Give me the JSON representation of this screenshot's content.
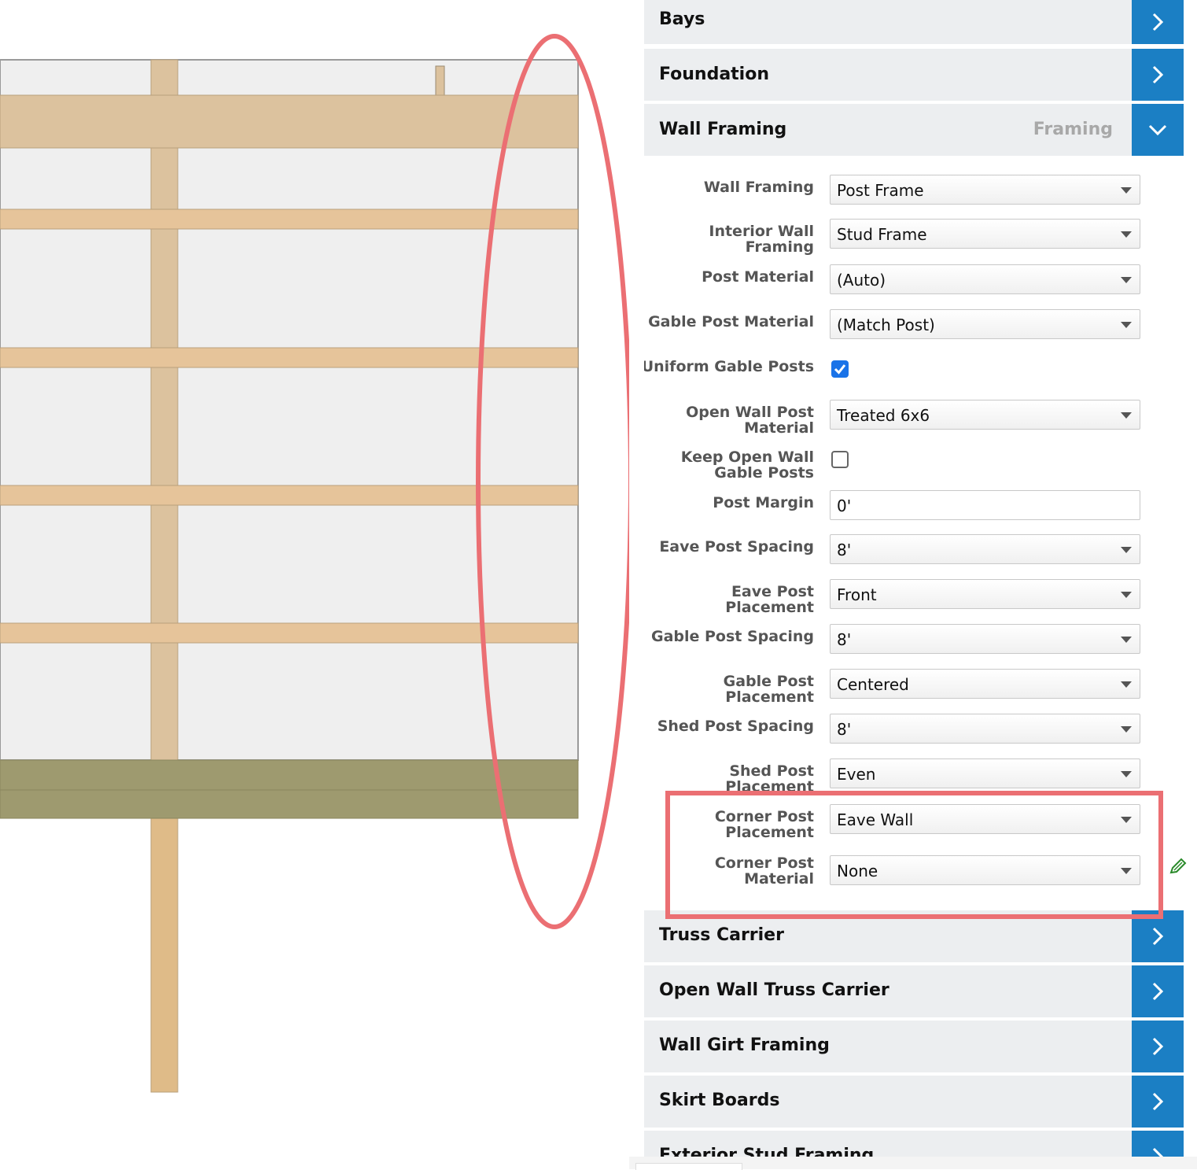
{
  "colors": {
    "accent": "#1b7fc4",
    "section_bg": "#eceef0",
    "annotation": "#eb6f73",
    "wood_post": "#dcc29e",
    "wood_girt": "#e6c49a",
    "foundation": "#9e9a6f",
    "wall_panel": "#efefef"
  },
  "sections_top": [
    {
      "title": "Bays",
      "icon": "chevron-right-icon"
    },
    {
      "title": "Foundation",
      "icon": "chevron-right-icon"
    },
    {
      "title": "Wall Framing",
      "subtitle": "Framing",
      "icon": "chevron-down-icon"
    }
  ],
  "wall_framing": {
    "fields": [
      {
        "label": "Wall Framing",
        "type": "select",
        "value": "Post Frame"
      },
      {
        "label": "Interior Wall Framing",
        "type": "select",
        "value": "Stud Frame"
      },
      {
        "label": "Post Material",
        "type": "select",
        "value": "(Auto)"
      },
      {
        "label": "Gable Post Material",
        "type": "select",
        "value": "(Match Post)"
      },
      {
        "label": "Uniform Gable Posts",
        "type": "checkbox",
        "checked": true
      },
      {
        "label": "Open Wall Post Material",
        "type": "select",
        "value": "Treated 6x6"
      },
      {
        "label": "Keep Open Wall Gable Posts",
        "type": "checkbox",
        "checked": false
      },
      {
        "label": "Post Margin",
        "type": "input",
        "value": "0'"
      },
      {
        "label": "Eave Post Spacing",
        "type": "select",
        "value": "8'"
      },
      {
        "label": "Eave Post Placement",
        "type": "select",
        "value": "Front"
      },
      {
        "label": "Gable Post Spacing",
        "type": "select",
        "value": "8'"
      },
      {
        "label": "Gable Post Placement",
        "type": "select",
        "value": "Centered"
      },
      {
        "label": "Shed Post Spacing",
        "type": "select",
        "value": "8'"
      },
      {
        "label": "Shed Post Placement",
        "type": "select",
        "value": "Even"
      },
      {
        "label": "Corner Post Placement",
        "type": "select",
        "value": "Eave Wall"
      },
      {
        "label": "Corner Post Material",
        "type": "select",
        "value": "None"
      }
    ]
  },
  "sections_bottom": [
    {
      "title": "Truss Carrier",
      "icon": "chevron-right-icon"
    },
    {
      "title": "Open Wall Truss Carrier",
      "icon": "chevron-right-icon"
    },
    {
      "title": "Wall Girt Framing",
      "icon": "chevron-right-icon"
    },
    {
      "title": "Skirt Boards",
      "icon": "chevron-right-icon"
    },
    {
      "title": "Exterior Stud Framing",
      "icon": "chevron-right-icon"
    }
  ],
  "icons": {
    "edit": "pencil-edit-icon"
  }
}
